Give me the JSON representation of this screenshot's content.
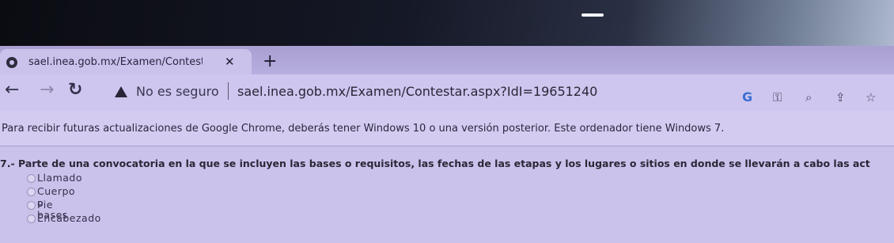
{
  "browser": {
    "tab": {
      "title": "sael.inea.gob.mx/Examen/Contesta"
    },
    "address_bar": {
      "security_label": "No es seguro",
      "url": "sael.inea.gob.mx/Examen/Contestar.aspx?IdI=19651240"
    },
    "toolbar_icons": [
      "google-icon",
      "key-icon",
      "zoom-icon",
      "share-icon",
      "star-icon"
    ]
  },
  "infobar": {
    "message": "Para recibir futuras actualizaciones de Google Chrome, deberás tener Windows 10 o una versión posterior. Este ordenador tiene Windows 7."
  },
  "question": {
    "number": "7.-",
    "text": "Parte de una convocatoria en la que se incluyen las bases o requisitos, las fechas de las etapas y los lugares o sitios en donde se llevarán a cabo las act",
    "options": [
      "Llamado",
      "Cuerpo o bases",
      "Pie",
      "Encabezado"
    ]
  }
}
